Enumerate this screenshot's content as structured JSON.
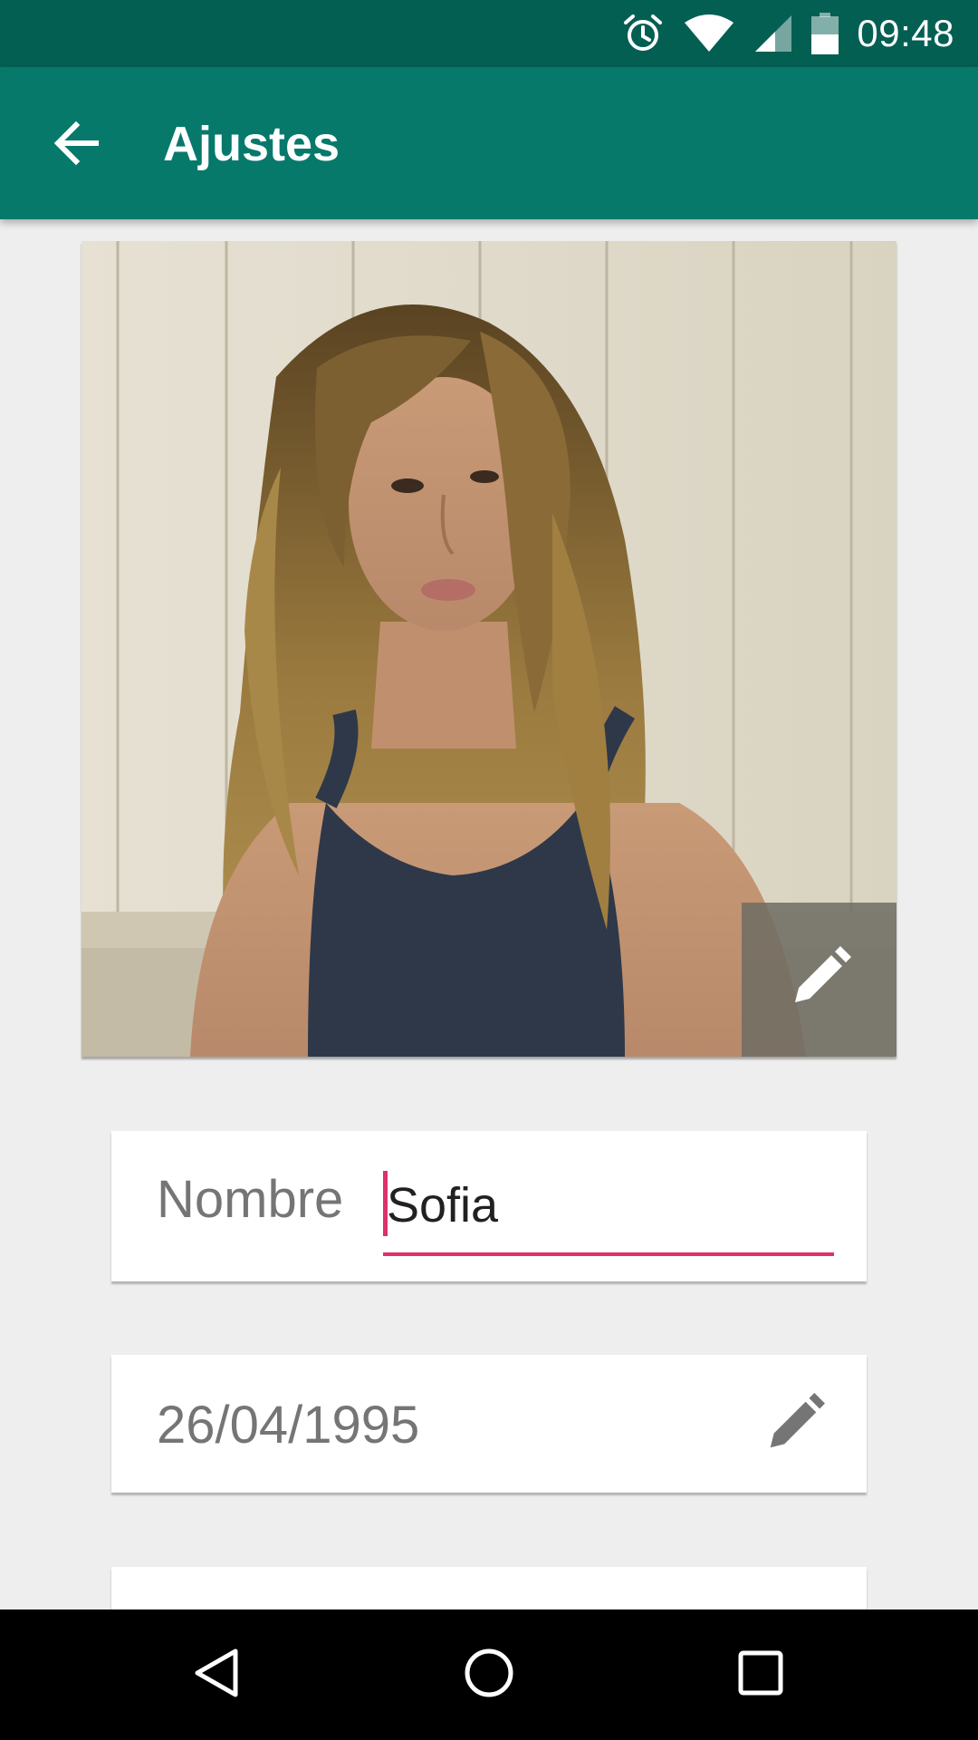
{
  "status_bar": {
    "time": "09:48",
    "icons": [
      "alarm-icon",
      "wifi-icon",
      "cell-signal-icon",
      "battery-icon"
    ]
  },
  "app_bar": {
    "title": "Ajustes",
    "back_icon": "arrow-back-icon"
  },
  "profile_photo": {
    "edit_icon": "pencil-icon"
  },
  "form": {
    "name_label": "Nombre",
    "name_value": "Sofia",
    "birthdate_value": "26/04/1995",
    "birthdate_edit_icon": "pencil-icon"
  },
  "nav_bar": {
    "icons": [
      "nav-back-icon",
      "nav-home-icon",
      "nav-recents-icon"
    ]
  },
  "colors": {
    "status_bar": "#045f53",
    "app_bar": "#06796b",
    "accent": "#e0306b",
    "background": "#eeeeee"
  }
}
